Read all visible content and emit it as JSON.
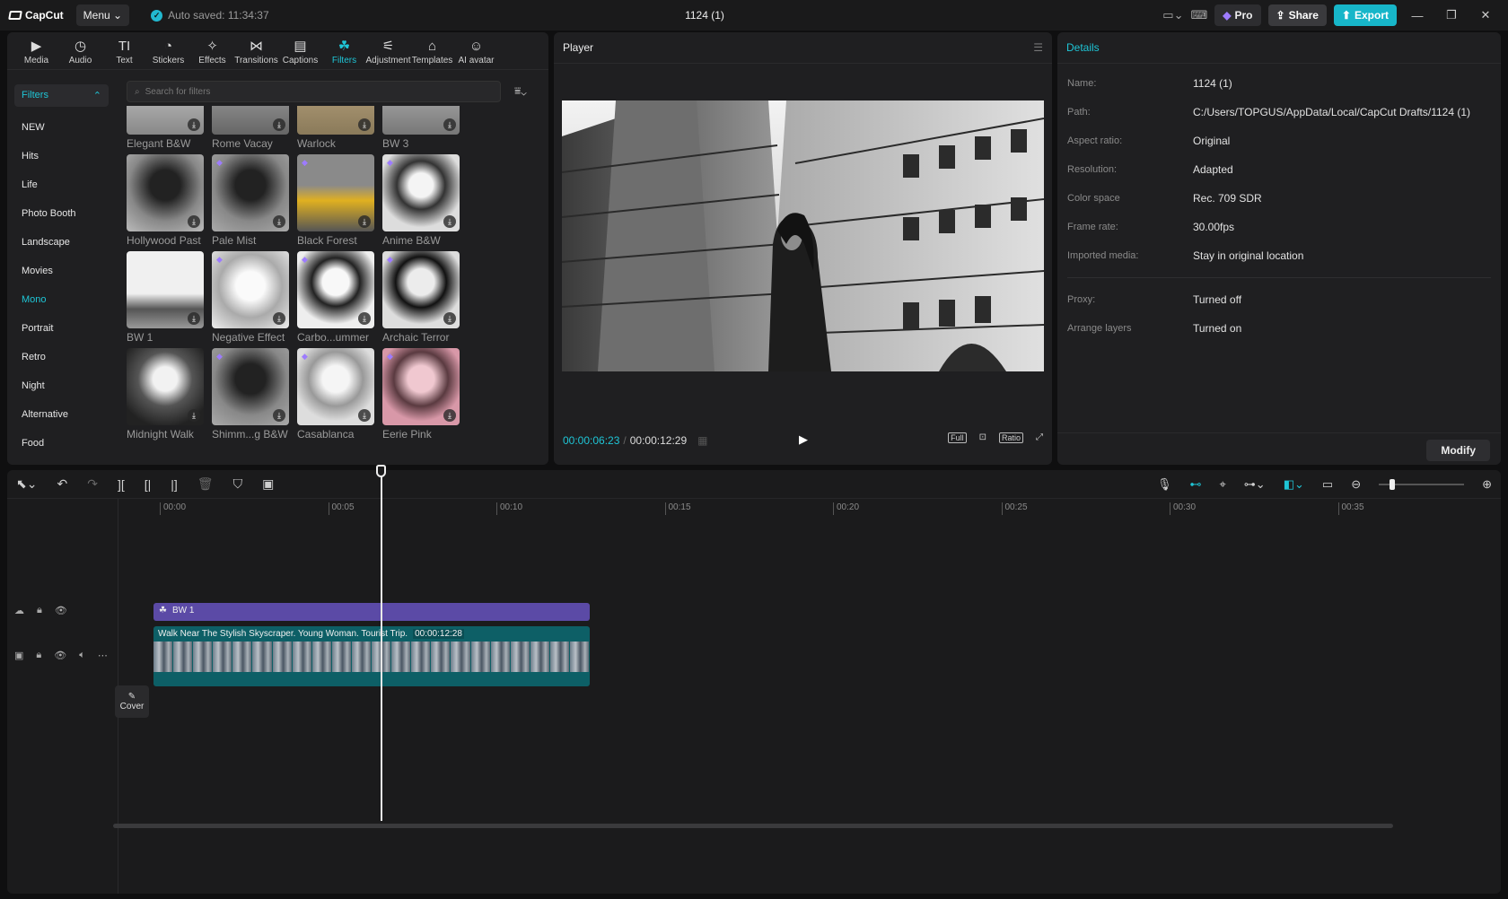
{
  "app": {
    "name": "CapCut",
    "menu_label": "Menu",
    "autosave": "Auto saved: 11:34:37",
    "project_title": "1124 (1)"
  },
  "titlebar": {
    "pro_label": "Pro",
    "share_label": "Share",
    "export_label": "Export",
    "accent": "#17b6c9"
  },
  "tools": [
    {
      "label": "Media",
      "icon": "media-icon"
    },
    {
      "label": "Audio",
      "icon": "audio-icon"
    },
    {
      "label": "Text",
      "icon": "text-icon"
    },
    {
      "label": "Stickers",
      "icon": "stickers-icon"
    },
    {
      "label": "Effects",
      "icon": "effects-icon"
    },
    {
      "label": "Transitions",
      "icon": "transitions-icon"
    },
    {
      "label": "Captions",
      "icon": "captions-icon"
    },
    {
      "label": "Filters",
      "icon": "filters-icon",
      "active": true
    },
    {
      "label": "Adjustment",
      "icon": "adjustment-icon"
    },
    {
      "label": "Templates",
      "icon": "templates-icon"
    },
    {
      "label": "AI avatar",
      "icon": "ai-avatar-icon"
    }
  ],
  "filters": {
    "header": "Filters",
    "search_placeholder": "Search for filters",
    "categories": [
      "NEW",
      "Hits",
      "Life",
      "Photo Booth",
      "Landscape",
      "Movies",
      "Mono",
      "Portrait",
      "Retro",
      "Night",
      "Alternative",
      "Food"
    ],
    "active_category": "Mono",
    "items": [
      {
        "label": "Elegant B&W"
      },
      {
        "label": "Rome Vacay"
      },
      {
        "label": "Warlock"
      },
      {
        "label": "BW 3"
      },
      {
        "label": "Hollywood Past"
      },
      {
        "label": "Pale Mist"
      },
      {
        "label": "Black Forest"
      },
      {
        "label": "Anime B&W"
      },
      {
        "label": "BW 1"
      },
      {
        "label": "Negative Effect"
      },
      {
        "label": "Carbo...ummer"
      },
      {
        "label": "Archaic Terror"
      },
      {
        "label": "Midnight Walk"
      },
      {
        "label": "Shimm...g B&W"
      },
      {
        "label": "Casablanca"
      },
      {
        "label": "Eerie Pink"
      }
    ]
  },
  "player": {
    "title": "Player",
    "current_time": "00:00:06:23",
    "duration": "00:00:12:29",
    "full_label": "Full",
    "ratio_label": "Ratio"
  },
  "details": {
    "title": "Details",
    "rows": [
      {
        "label": "Name:",
        "value": "1124 (1)"
      },
      {
        "label": "Path:",
        "value": "C:/Users/TOPGUS/AppData/Local/CapCut Drafts/1124 (1)"
      },
      {
        "label": "Aspect ratio:",
        "value": "Original"
      },
      {
        "label": "Resolution:",
        "value": "Adapted"
      },
      {
        "label": "Color space",
        "value": "Rec. 709 SDR"
      },
      {
        "label": "Frame rate:",
        "value": "30.00fps"
      },
      {
        "label": "Imported media:",
        "value": "Stay in original location"
      }
    ],
    "rows2": [
      {
        "label": "Proxy:",
        "value": "Turned off"
      },
      {
        "label": "Arrange layers",
        "value": "Turned on"
      }
    ],
    "modify_label": "Modify"
  },
  "timeline": {
    "ticks": [
      "00:00",
      "00:05",
      "00:10",
      "00:15",
      "00:20",
      "00:25",
      "00:30",
      "00:35"
    ],
    "filter_clip_label": "BW 1",
    "video_clip_title": "Walk Near The Stylish Skyscraper. Young Woman. Tourist Trip.",
    "video_clip_duration": "00:00:12:28",
    "cover_label": "Cover"
  }
}
